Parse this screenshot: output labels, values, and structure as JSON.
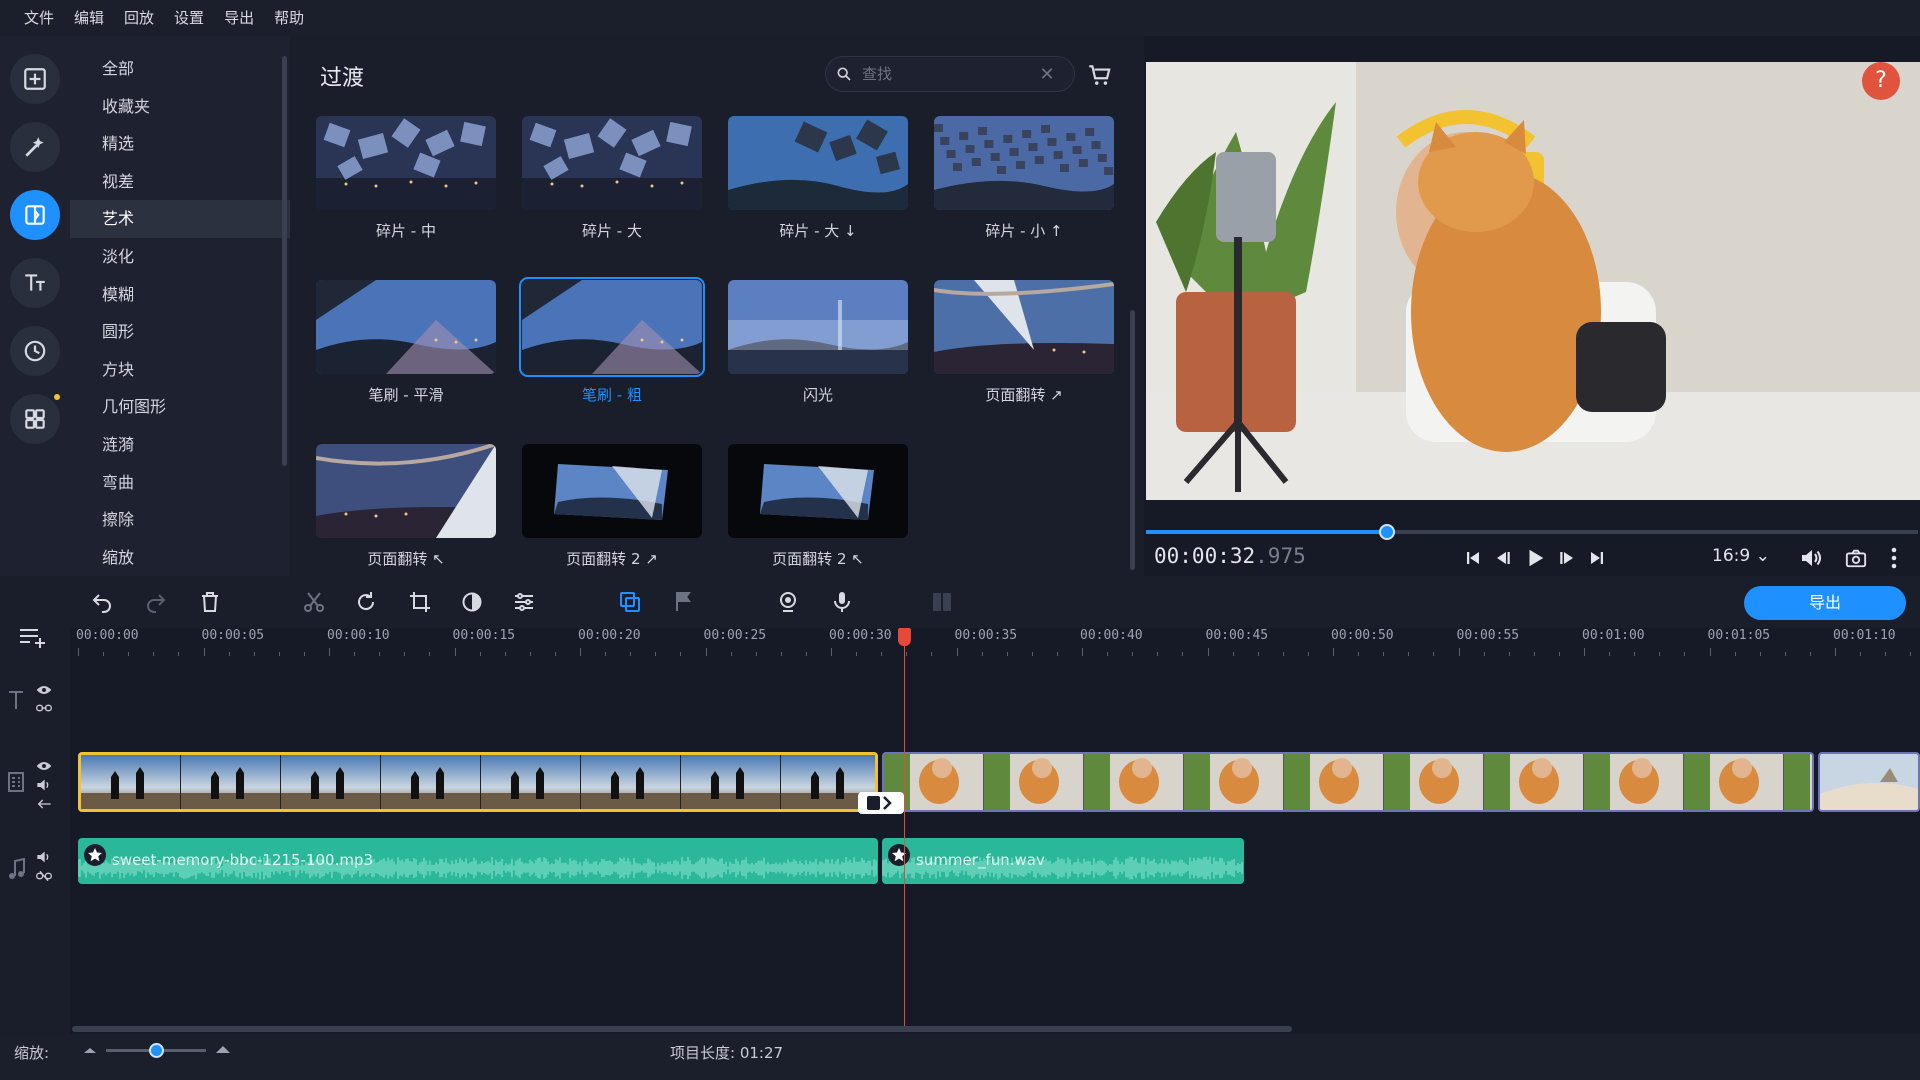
{
  "menubar": [
    "文件",
    "编辑",
    "回放",
    "设置",
    "导出",
    "帮助"
  ],
  "left_tools": [
    {
      "name": "import-icon"
    },
    {
      "name": "filters-icon"
    },
    {
      "name": "transitions-icon"
    },
    {
      "name": "titles-icon"
    },
    {
      "name": "stickers-icon"
    },
    {
      "name": "more-tools-icon"
    }
  ],
  "categories": [
    "全部",
    "收藏夹",
    "精选",
    "视差",
    "艺术",
    "淡化",
    "模糊",
    "圆形",
    "方块",
    "几何图形",
    "涟漪",
    "弯曲",
    "擦除",
    "缩放"
  ],
  "active_category": "艺术",
  "panel": {
    "title": "过渡",
    "search_placeholder": "查找"
  },
  "transitions": [
    {
      "label": "碎片 - 中",
      "style": "shards"
    },
    {
      "label": "碎片 - 大",
      "style": "shards"
    },
    {
      "label": "碎片 - 大 ↓",
      "style": "shards-day"
    },
    {
      "label": "碎片 - 小 ↑",
      "style": "shards-small"
    },
    {
      "label": "笔刷 - 平滑",
      "style": "brush"
    },
    {
      "label": "笔刷 - 粗",
      "style": "brush"
    },
    {
      "label": "闪光",
      "style": "flash"
    },
    {
      "label": "页面翻转 ↗",
      "style": "page"
    },
    {
      "label": "页面翻转 ↖",
      "style": "page2"
    },
    {
      "label": "页面翻转 2 ↗",
      "style": "framed"
    },
    {
      "label": "页面翻转 2 ↖",
      "style": "framed"
    }
  ],
  "selected_transition": "笔刷 - 粗",
  "player": {
    "timecode": "00:00:32",
    "timecode_ms": ".975",
    "progress": 0.312,
    "aspect": "16:9",
    "help": "?"
  },
  "timeline": {
    "export_label": "导出",
    "ruler": [
      "00:00:00",
      "00:00:05",
      "00:00:10",
      "00:00:15",
      "00:00:20",
      "00:00:25",
      "00:00:30",
      "00:00:35",
      "00:00:40",
      "00:00:45",
      "00:00:50",
      "00:00:55",
      "00:01:00",
      "00:01:05",
      "00:01:10"
    ],
    "audio_clips": [
      {
        "name": "sweet-memory-bbc-1215-100.mp3"
      },
      {
        "name": "summer_fun.wav"
      }
    ]
  },
  "status": {
    "zoom_label": "缩放:",
    "project_length": "项目长度: 01:27",
    "zoom_level": 0.5
  },
  "colors": {
    "accent": "#1e90ff",
    "selected_clip": "#f2c230",
    "audio": "#2bb79a",
    "playhead": "#e8483a"
  }
}
